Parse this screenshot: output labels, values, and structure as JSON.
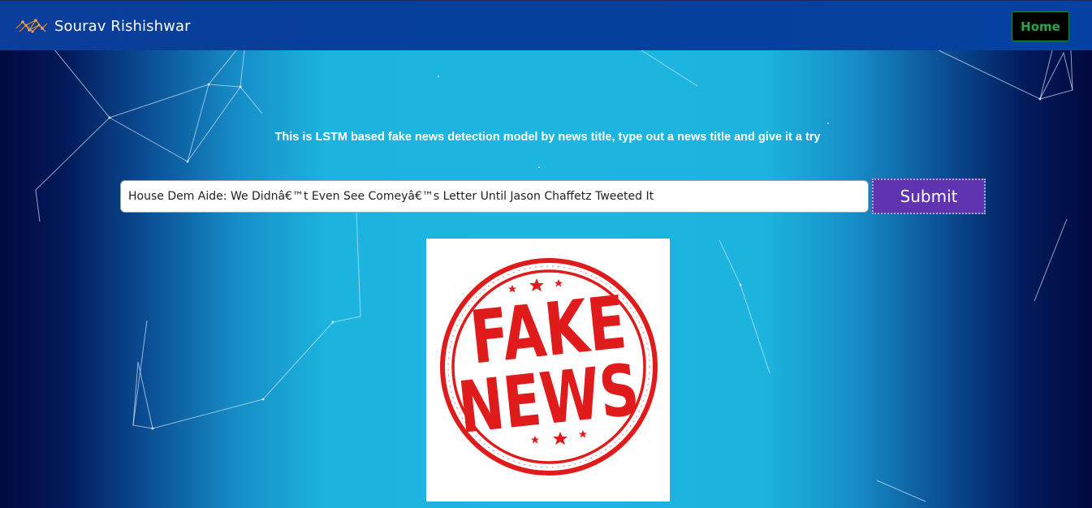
{
  "navbar": {
    "brand_name": "Sourav Rishishwar",
    "brand_icon": "network-graph-icon",
    "home_label": "Home"
  },
  "main": {
    "tagline": "This is LSTM based fake news detection model by news title, type out a news title and give it a try",
    "input_value": "House Dem Aide: We Didnâ€™t Even See Comeyâ€™s Letter Until Jason Chaffetz Tweeted It",
    "submit_label": "Submit"
  },
  "result": {
    "stamp_line1": "FAKE",
    "stamp_line2": "NEWS",
    "stamp_color": "#e01b1b"
  },
  "colors": {
    "navbar": "#05409c",
    "home_text": "#29a849",
    "submit_bg": "#6033b0",
    "background_center": "#1db6e0",
    "background_edge": "#01093f"
  }
}
